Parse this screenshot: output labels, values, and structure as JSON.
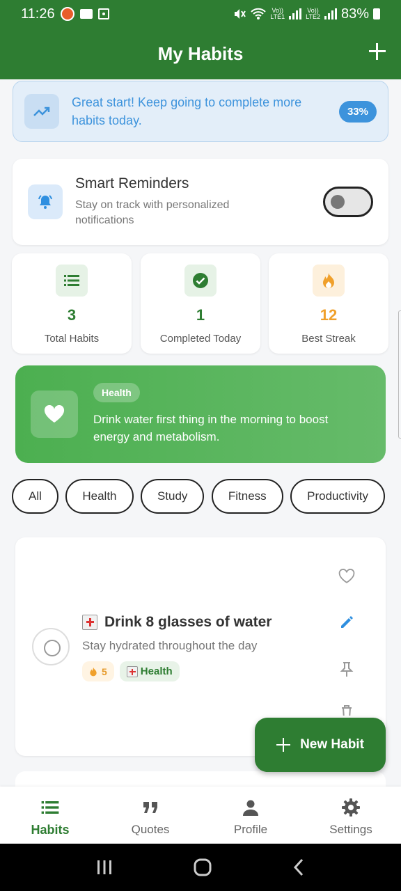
{
  "status_bar": {
    "time": "11:26",
    "net1_top": "Vo))",
    "net1_bottom": "LTE1",
    "net2_top": "Vo))",
    "net2_bottom": "LTE2",
    "battery": "83%"
  },
  "app_bar": {
    "title": "My Habits"
  },
  "progress_banner": {
    "message": "Great start! Keep going to complete more habits today.",
    "percent_label": "33%",
    "percent_value": 33,
    "color": "#3d93dc"
  },
  "reminders": {
    "title": "Smart Reminders",
    "subtitle": "Stay on track with personalized notifications",
    "enabled": false
  },
  "stats": [
    {
      "value": "3",
      "label": "Total Habits",
      "icon": "list-icon",
      "color": "#2e7d32"
    },
    {
      "value": "1",
      "label": "Completed Today",
      "icon": "check-circle-icon",
      "color": "#2e7d32"
    },
    {
      "value": "12",
      "label": "Best Streak",
      "icon": "fire-icon",
      "color": "#f0a02b"
    }
  ],
  "tip": {
    "tag": "Health",
    "text": "Drink water first thing in the morning to boost energy and metabolism.",
    "icon": "heart-icon"
  },
  "filters": [
    "All",
    "Health",
    "Study",
    "Fitness",
    "Productivity"
  ],
  "habits": [
    {
      "title": "Drink 8 glasses of water",
      "description": "Stay hydrated throughout the day",
      "streak": "5",
      "category": "Health",
      "completed": false
    }
  ],
  "fab": {
    "label": "New Habit"
  },
  "bottom_nav": [
    {
      "label": "Habits",
      "icon": "list-icon",
      "active": true
    },
    {
      "label": "Quotes",
      "icon": "quote-icon",
      "active": false
    },
    {
      "label": "Profile",
      "icon": "person-icon",
      "active": false
    },
    {
      "label": "Settings",
      "icon": "gear-icon",
      "active": false
    }
  ],
  "colors": {
    "primary": "#2e7d32",
    "accent_blue": "#3d93dc",
    "streak_orange": "#f0a02b"
  }
}
